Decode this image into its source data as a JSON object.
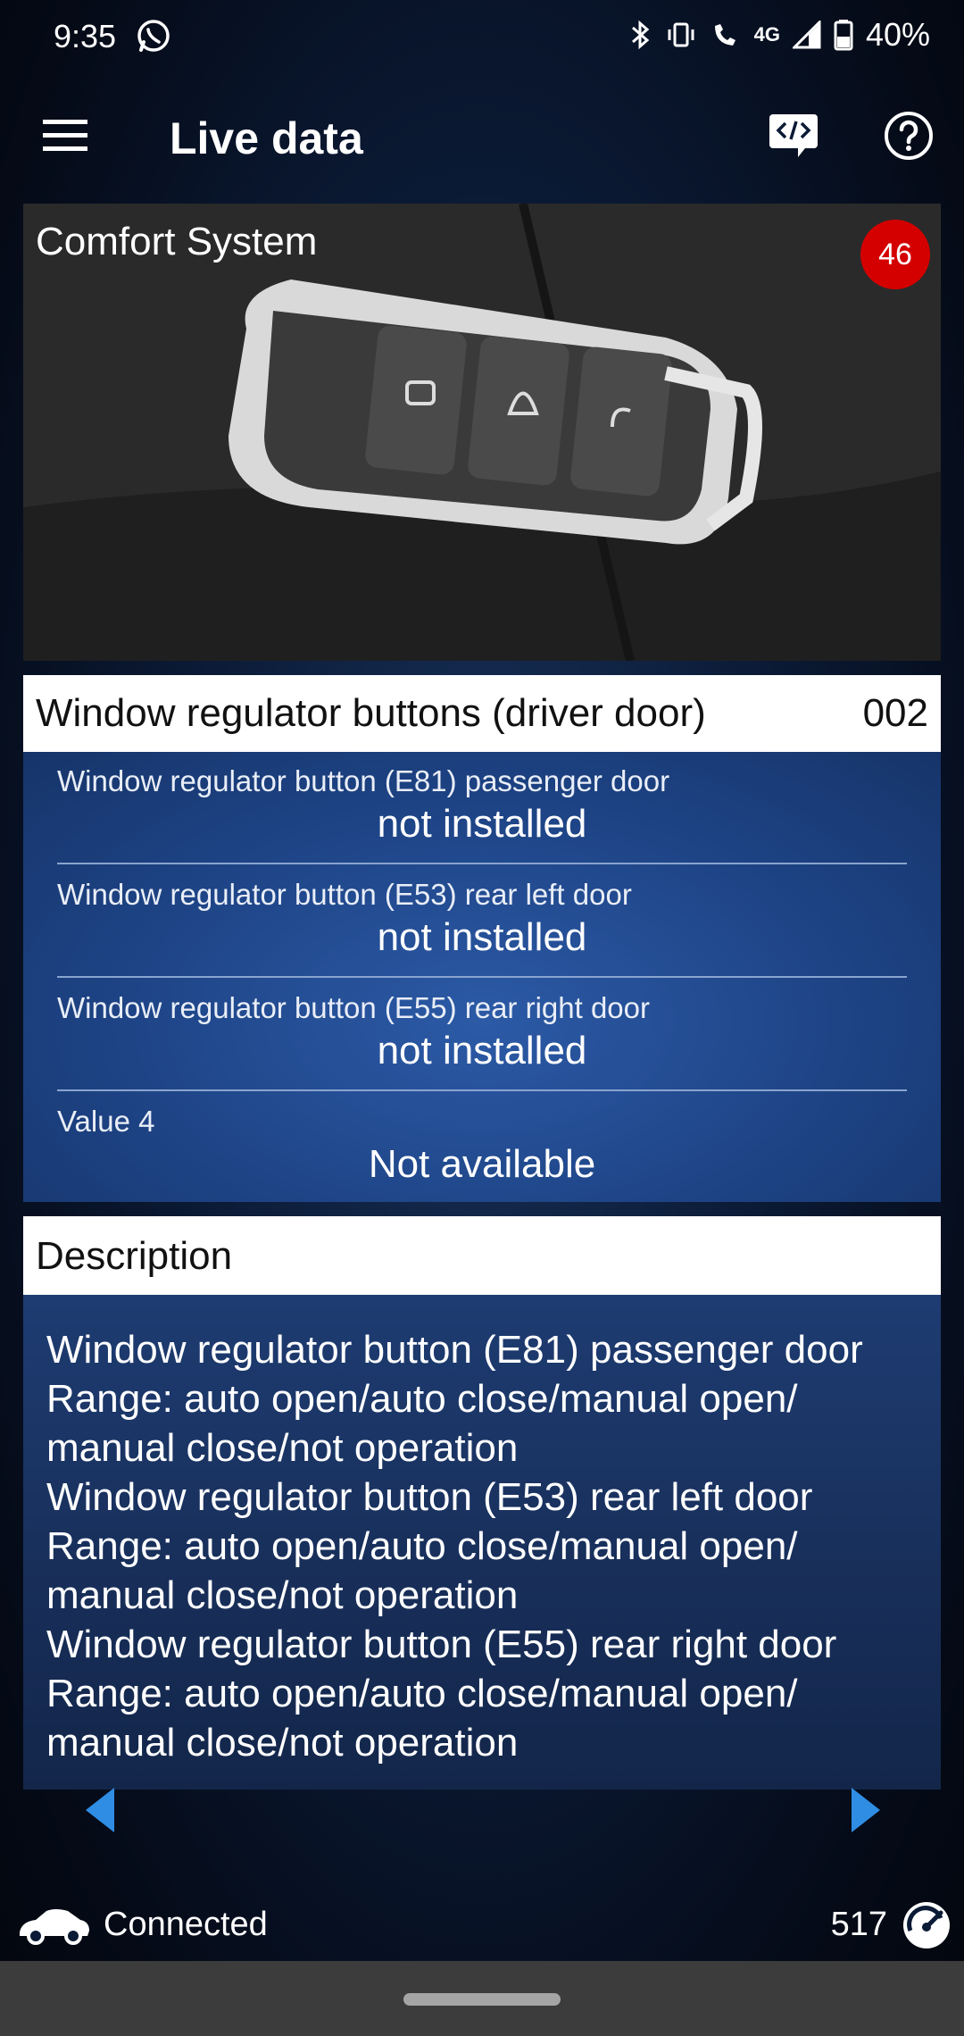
{
  "status": {
    "time": "9:35",
    "network": "4G",
    "battery": "40%"
  },
  "app_bar": {
    "title": "Live data"
  },
  "module": {
    "name": "Comfort System",
    "badge": "46"
  },
  "group": {
    "title": "Window regulator buttons (driver door)",
    "id": "002",
    "values": [
      {
        "label": "Window regulator button (E81) passenger door",
        "value": "not installed"
      },
      {
        "label": "Window regulator button (E53) rear left door",
        "value": "not installed"
      },
      {
        "label": "Window regulator button (E55) rear right door",
        "value": "not installed"
      },
      {
        "label": "Value 4",
        "value": "Not available"
      }
    ]
  },
  "description": {
    "title": "Description",
    "text": "Window regulator button (E81) passenger door\n Range: auto open/auto close/manual open/\nmanual close/not operation\nWindow regulator button (E53) rear left door\n Range: auto open/auto close/manual open/\nmanual close/not operation\nWindow regulator button (E55) rear right door\n Range: auto open/auto close/manual open/\nmanual close/not operation"
  },
  "footer": {
    "connection": "Connected",
    "count": "517"
  },
  "colors": {
    "badge": "#d40000",
    "arrow": "#2f8de4",
    "card_blue": "#1e4486"
  }
}
